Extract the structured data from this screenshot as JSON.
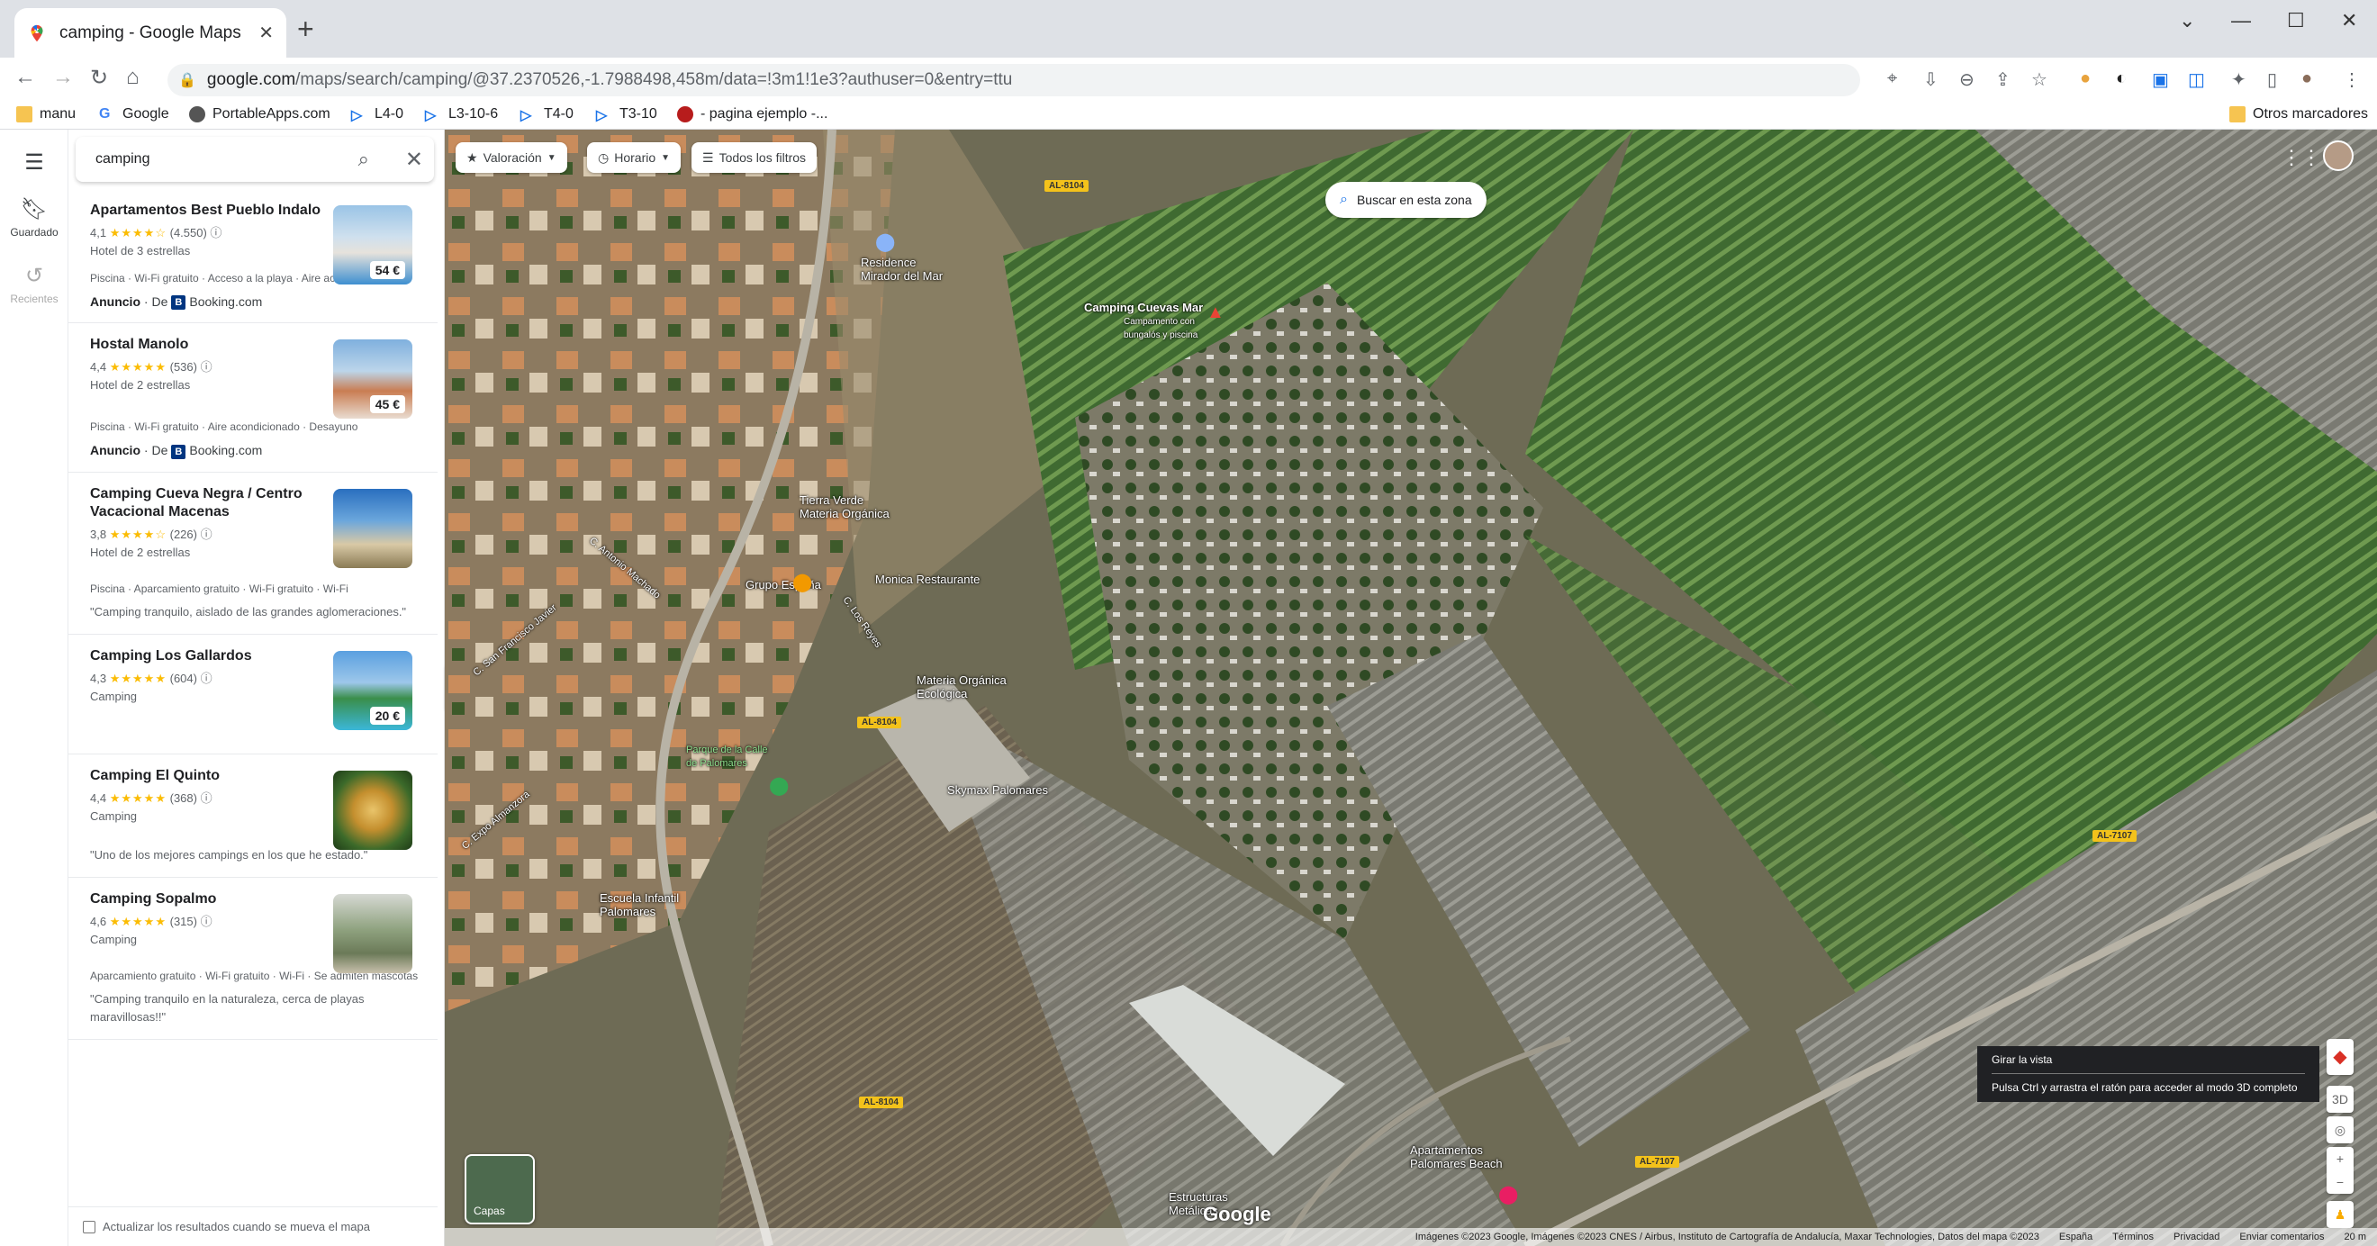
{
  "browser": {
    "tab_title": "camping - Google Maps",
    "url_domain": "google.com",
    "url_path": "/maps/search/camping/@37.2370526,-1.7988498,458m/data=!3m1!1e3?authuser=0&entry=ttu",
    "bookmarks": [
      "manu",
      "Google",
      "PortableApps.com",
      "L4-0",
      "L3-10-6",
      "T4-0",
      "T3-10",
      "- pagina ejemplo -..."
    ],
    "other_bookmarks": "Otros marcadores"
  },
  "rail": {
    "saved": "Guardado",
    "recent": "Recientes"
  },
  "search": {
    "query": "camping"
  },
  "results": [
    {
      "name": "Apartamentos Best Pueblo Indalo",
      "rating": "4,1",
      "stars": "★★★★☆",
      "reviews": "(4.550)",
      "type": "Hotel de 3 estrellas",
      "price": "54 €",
      "amenities": "Piscina · Wi-Fi gratuito · Acceso a la playa · Aire acondicionado",
      "ad_label": "Anuncio",
      "ad_from": "De",
      "ad_site": "Booking.com",
      "quote": ""
    },
    {
      "name": "Hostal Manolo",
      "rating": "4,4",
      "stars": "★★★★★",
      "reviews": "(536)",
      "type": "Hotel de 2 estrellas",
      "price": "45 €",
      "amenities": "Piscina · Wi-Fi gratuito · Aire acondicionado · Desayuno",
      "ad_label": "Anuncio",
      "ad_from": "De",
      "ad_site": "Booking.com",
      "quote": ""
    },
    {
      "name": "Camping Cueva Negra / Centro Vacacional Macenas",
      "rating": "3,8",
      "stars": "★★★★☆",
      "reviews": "(226)",
      "type": "Hotel de 2 estrellas",
      "price": "",
      "amenities": "Piscina · Aparcamiento gratuito · Wi-Fi gratuito · Wi-Fi",
      "ad_label": "",
      "ad_from": "",
      "ad_site": "",
      "quote": "\"Camping tranquilo, aislado de las grandes aglomeraciones.\""
    },
    {
      "name": "Camping Los Gallardos",
      "rating": "4,3",
      "stars": "★★★★★",
      "reviews": "(604)",
      "type": "Camping",
      "price": "20 €",
      "amenities": "",
      "ad_label": "",
      "ad_from": "",
      "ad_site": "",
      "quote": ""
    },
    {
      "name": "Camping El Quinto",
      "rating": "4,4",
      "stars": "★★★★★",
      "reviews": "(368)",
      "type": "Camping",
      "price": "",
      "amenities": "",
      "ad_label": "",
      "ad_from": "",
      "ad_site": "",
      "quote": "\"Uno de los mejores campings en los que he estado.\""
    },
    {
      "name": "Camping Sopalmo",
      "rating": "4,6",
      "stars": "★★★★★",
      "reviews": "(315)",
      "type": "Camping",
      "price": "",
      "amenities": "Aparcamiento gratuito · Wi-Fi gratuito · Wi-Fi · Se admiten mascotas",
      "ad_label": "",
      "ad_from": "",
      "ad_site": "",
      "quote": "\"Camping tranquilo en la naturaleza, cerca de playas maravillosas!!\""
    }
  ],
  "update_checkbox": "Actualizar los resultados cuando se mueva el mapa",
  "map": {
    "chips": {
      "rating": "Valoración",
      "hours": "Horario",
      "filters": "Todos los filtros"
    },
    "search_zone": "Buscar en esta zona",
    "labels": [
      {
        "text": "Residence\nMirador del Mar"
      },
      {
        "text": "Camping Cuevas Mar"
      },
      {
        "text": "Campamento con\nbungalós y piscina"
      },
      {
        "text": "Tierra Verde\nMateria Orgánica"
      },
      {
        "text": "Monica Restaurante"
      },
      {
        "text": "Grupo España"
      },
      {
        "text": "Materia Orgánica\nEcológica"
      },
      {
        "text": "Skymax Palomares"
      },
      {
        "text": "Parque de la Calle\nde Palomares"
      },
      {
        "text": "Escuela Infantil\nPalomares"
      },
      {
        "text": "Apartamentos\nPalomares Beach"
      },
      {
        "text": "Estructuras\nMetálicas..."
      },
      {
        "text": "C. Antonio Machado"
      },
      {
        "text": "C. San Francisco Javier"
      },
      {
        "text": "C. Expo Almanzora"
      },
      {
        "text": "C. Los Reyes"
      }
    ],
    "roads": [
      "AL-8104",
      "AL-8104",
      "AL-8104",
      "AL-7107",
      "AL-7107"
    ],
    "layers_label": "Capas",
    "tooltip_title": "Girar la vista",
    "tooltip_text": "Pulsa Ctrl y arrastra el ratón para acceder al modo 3D completo",
    "ctl_3d": "3D",
    "google_logo": "Google",
    "attribution": "Imágenes ©2023 Google, Imágenes ©2023 CNES / Airbus, Instituto de Cartografía de Andalucía, Maxar Technologies, Datos del mapa ©2023",
    "footer_links": [
      "España",
      "Términos",
      "Privacidad",
      "Enviar comentarios"
    ],
    "scale": "20 m"
  }
}
